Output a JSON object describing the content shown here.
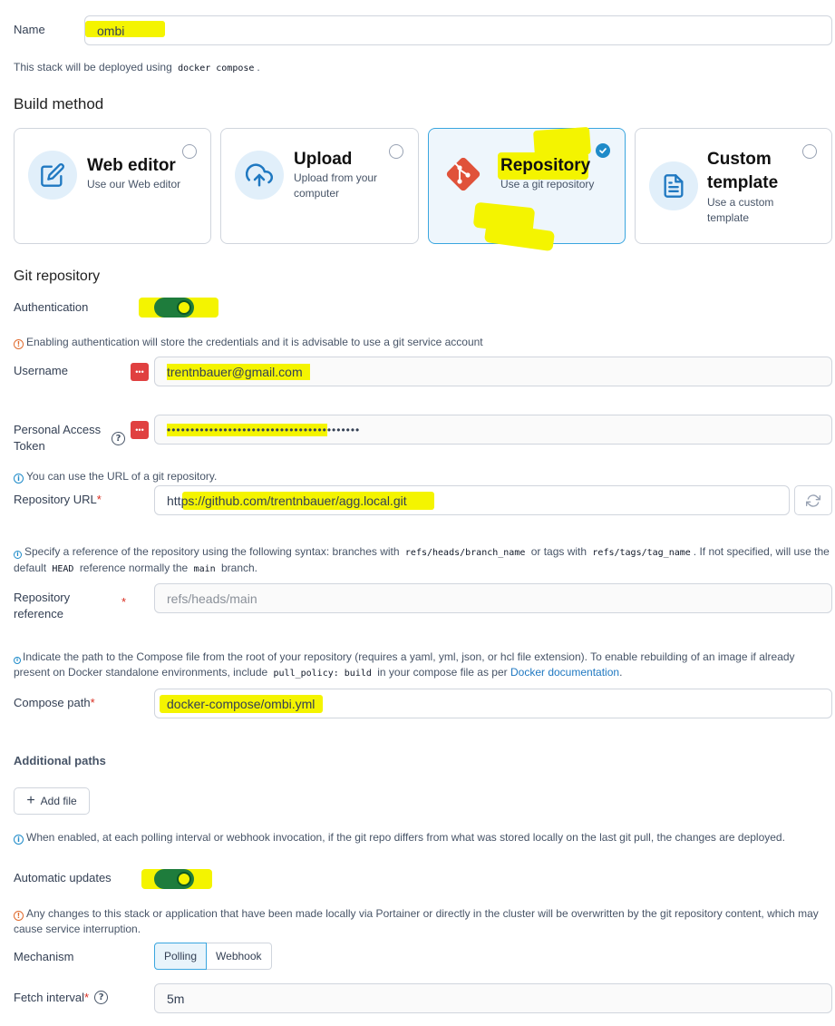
{
  "name": {
    "label": "Name",
    "value": "ombi"
  },
  "deploy_note": {
    "prefix": "This stack will be deployed using",
    "code": "docker compose",
    "suffix": "."
  },
  "build_method": {
    "heading": "Build method",
    "options": [
      {
        "title": "Web editor",
        "desc": "Use our Web editor",
        "icon": "edit-icon",
        "selected": false
      },
      {
        "title": "Upload",
        "desc": "Upload from your computer",
        "icon": "cloud-upload-icon",
        "selected": false
      },
      {
        "title": "Repository",
        "desc": "Use a git repository",
        "icon": "git-icon",
        "selected": true
      },
      {
        "title": "Custom template",
        "desc": "Use a custom template",
        "icon": "file-text-icon",
        "selected": false
      }
    ]
  },
  "git": {
    "heading": "Git repository",
    "authentication": {
      "label": "Authentication",
      "enabled": true
    },
    "auth_warning": "Enabling authentication will store the credentials and it is advisable to use a git service account",
    "username": {
      "label": "Username",
      "value": "trentnbauer@gmail.com"
    },
    "token": {
      "label": "Personal Access Token",
      "value": "•••••••••••••••••••••••••••••••••••••••••"
    },
    "url_note": "You can use the URL of a git repository.",
    "repo_url": {
      "label": "Repository URL",
      "value": "https://github.com/trentnbauer/agg.local.git"
    },
    "ref_note": {
      "p1": "Specify a reference of the repository using the following syntax: branches with",
      "c1": "refs/heads/branch_name",
      "p2": "or tags with",
      "c2": "refs/tags/tag_name",
      "p3": ". If not specified, will use the default",
      "c3": "HEAD",
      "p4": "reference normally the",
      "c4": "main",
      "p5": "branch."
    },
    "repo_ref": {
      "label": "Repository reference",
      "placeholder": "refs/heads/main"
    },
    "compose_note": {
      "p1": "Indicate the path to the Compose file from the root of your repository (requires a yaml, yml, json, or hcl file extension).  To enable rebuilding of an image if already present on Docker standalone environments, include",
      "c1": "pull_policy: build",
      "p2": "in your compose file as per",
      "link": "Docker documentation",
      "p3": "."
    },
    "compose_path": {
      "label": "Compose path",
      "value": "docker-compose/ombi.yml"
    },
    "additional_paths": {
      "heading": "Additional paths",
      "add_button": "Add file"
    },
    "auto_note": "When enabled, at each polling interval or webhook invocation, if the git repo differs from what was stored locally on the last git pull, the changes are deployed.",
    "auto_updates": {
      "label": "Automatic updates",
      "enabled": true
    },
    "overwrite_warning": "Any changes to this stack or application that have been made locally via Portainer or directly in the cluster will be overwritten by the git repository content, which may cause service interruption.",
    "mechanism": {
      "label": "Mechanism",
      "options": [
        "Polling",
        "Webhook"
      ],
      "selected": "Polling"
    },
    "fetch_interval": {
      "label": "Fetch interval",
      "value": "5m"
    }
  }
}
